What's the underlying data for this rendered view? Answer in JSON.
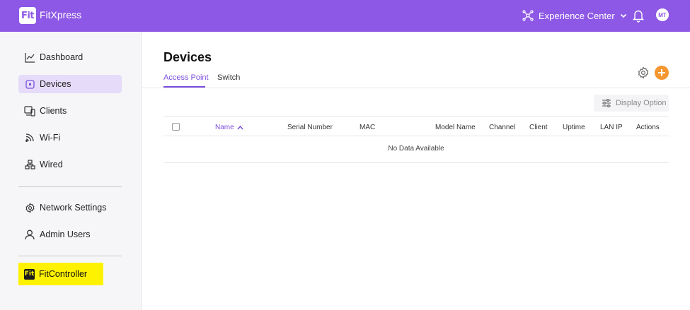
{
  "header": {
    "logo_text": "Fit",
    "app_title": "FitXpress",
    "workspace": "Experience Center",
    "user_initials": "MT",
    "brand_color": "#8e58e6"
  },
  "sidebar": {
    "items": [
      {
        "label": "Dashboard",
        "icon": "chart-line-icon"
      },
      {
        "label": "Devices",
        "icon": "device-icon",
        "active": true
      },
      {
        "label": "Clients",
        "icon": "client-devices-icon"
      },
      {
        "label": "Wi-Fi",
        "icon": "wifi-icon"
      },
      {
        "label": "Wired",
        "icon": "wired-network-icon"
      },
      {
        "label": "Network Settings",
        "icon": "gear-icon"
      },
      {
        "label": "Admin Users",
        "icon": "user-icon"
      }
    ],
    "fitcontroller": {
      "label": "FitController",
      "logo_text": "Fit",
      "highlight": "#fff200"
    }
  },
  "main": {
    "title": "Devices",
    "tabs": [
      {
        "label": "Access Point",
        "active": true
      },
      {
        "label": "Switch"
      }
    ],
    "display_option": "Display Option",
    "accent": "#7b4fdb",
    "add_color": "#f5962f",
    "table": {
      "columns": [
        "Name",
        "Serial Number",
        "MAC",
        "Model Name",
        "Channel",
        "Client",
        "Uptime",
        "LAN IP",
        "Actions"
      ],
      "sorted_column": "Name",
      "empty_text": "No Data Available"
    }
  }
}
